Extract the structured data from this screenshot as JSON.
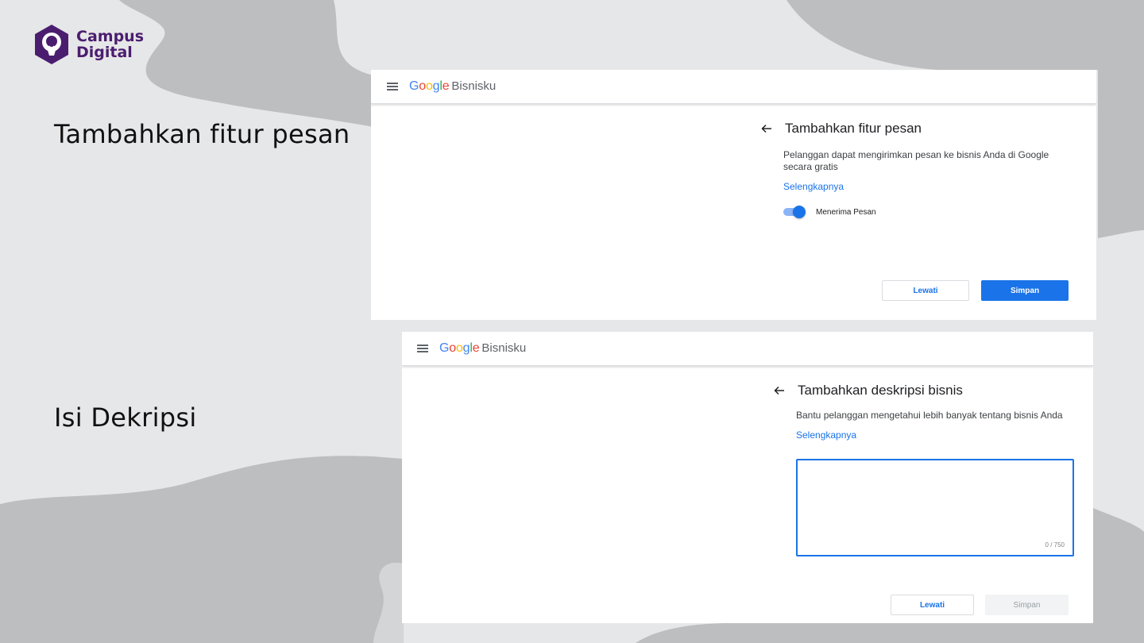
{
  "logo": {
    "line1": "Campus",
    "line2": "Digital",
    "color": "#4b1d6f"
  },
  "labels": {
    "step1": "Tambahkan fitur pesan",
    "step2": "Isi Dekripsi"
  },
  "panel1": {
    "brand": "Bisnisku",
    "title": "Tambahkan fitur pesan",
    "description_line1": "Pelanggan dapat mengirimkan pesan ke bisnis Anda di Google",
    "description_line2": "secara gratis",
    "link": "Selengkapnya",
    "toggle_label": "Menerima Pesan",
    "toggle_on": true,
    "skip_label": "Lewati",
    "save_label": "Simpan"
  },
  "panel2": {
    "brand": "Bisnisku",
    "title": "Tambahkan deskripsi bisnis",
    "description": "Bantu pelanggan mengetahui lebih banyak tentang bisnis Anda",
    "link": "Selengkapnya",
    "counter": "0 / 750",
    "textarea_value": "",
    "skip_label": "Lewati",
    "save_label": "Simpan"
  },
  "colors": {
    "accent": "#1a73e8",
    "background": "#e6e7e8",
    "blob": "#bdbec0"
  }
}
